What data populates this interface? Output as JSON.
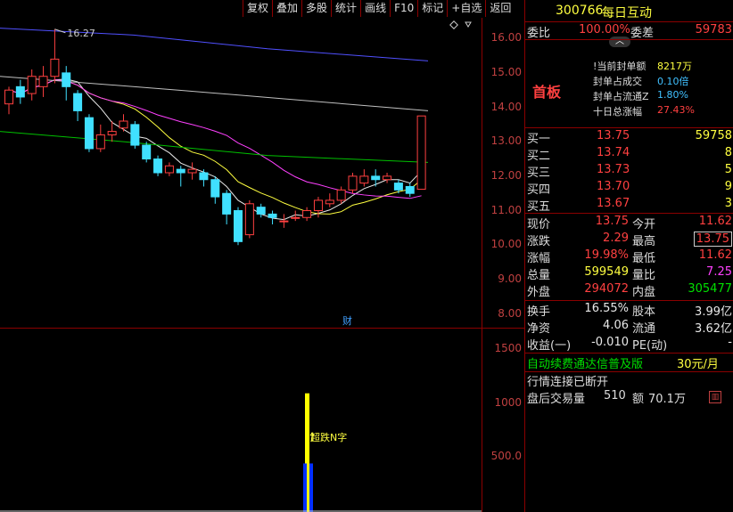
{
  "toolbar": [
    "复权",
    "叠加",
    "多股",
    "统计",
    "画线",
    "F10",
    "标记",
    "+自选",
    "返回"
  ],
  "header": {
    "code": "300766",
    "name": "每日互动"
  },
  "commission": {
    "ratio_label": "委比",
    "ratio": "100.00%",
    "diff_label": "委差",
    "diff": "59783"
  },
  "limit_up": {
    "tag": "首板",
    "lines": [
      {
        "label": "!当前封单额",
        "value": "8217万"
      },
      {
        "label": "封单占成交",
        "value": "0.10倍"
      },
      {
        "label": "封单占流通Z",
        "value": "1.80%"
      },
      {
        "label": "十日总涨幅",
        "value": "27.43%"
      }
    ]
  },
  "bids": [
    {
      "label": "买一",
      "price": "13.75",
      "vol": "59758"
    },
    {
      "label": "买二",
      "price": "13.74",
      "vol": "8"
    },
    {
      "label": "买三",
      "price": "13.73",
      "vol": "5"
    },
    {
      "label": "买四",
      "price": "13.70",
      "vol": "9"
    },
    {
      "label": "买五",
      "price": "13.67",
      "vol": "3"
    }
  ],
  "quote": [
    {
      "l1": "现价",
      "v1": "13.75",
      "l2": "今开",
      "v2": "11.62"
    },
    {
      "l1": "涨跌",
      "v1": "2.29",
      "l2": "最高",
      "v2": "13.75"
    },
    {
      "l1": "涨幅",
      "v1": "19.98%",
      "l2": "最低",
      "v2": "11.62"
    },
    {
      "l1": "总量",
      "v1": "599549",
      "l2": "量比",
      "v2": "7.25"
    },
    {
      "l1": "外盘",
      "v1": "294072",
      "l2": "内盘",
      "v2": "305477"
    }
  ],
  "fund": [
    {
      "l1": "换手",
      "v1": "16.55%",
      "l2": "股本",
      "v2": "3.99亿"
    },
    {
      "l1": "净资",
      "v1": "4.06",
      "l2": "流通",
      "v2": "3.62亿"
    },
    {
      "l1": "收益(一)",
      "v1": "-0.010",
      "l2": "PE(动)",
      "v2": "-"
    }
  ],
  "promo": {
    "text": "自动续费通达信普及版",
    "price": "30元/月"
  },
  "status": "行情连接已断开",
  "after_hours": {
    "label": "盘后交易量",
    "vol": "510",
    "amt_label": "额",
    "amt": "70.1万"
  },
  "chart": {
    "high_label": "16.27",
    "cai_label": "财",
    "signal_label": "超跌N字",
    "price_ticks": [
      "16.00",
      "15.00",
      "14.00",
      "13.00",
      "12.00",
      "11.00",
      "10.00",
      "9.00",
      "8.00"
    ],
    "vol_ticks": [
      "1500",
      "1000",
      "500.0"
    ]
  },
  "chart_data": {
    "type": "candlestick",
    "ylim": [
      7.6,
      16.6
    ],
    "candles": [
      [
        14.1,
        14.5,
        13.8,
        14.6
      ],
      [
        14.6,
        14.3,
        14.1,
        14.8
      ],
      [
        14.4,
        14.9,
        14.2,
        15.1
      ],
      [
        14.6,
        14.9,
        14.3,
        15.2
      ],
      [
        14.9,
        15.4,
        14.7,
        16.27
      ],
      [
        15.0,
        14.6,
        14.2,
        15.2
      ],
      [
        14.4,
        13.9,
        13.6,
        14.5
      ],
      [
        13.7,
        12.8,
        12.7,
        13.8
      ],
      [
        12.8,
        13.2,
        12.7,
        13.5
      ],
      [
        13.2,
        13.3,
        13.0,
        13.6
      ],
      [
        13.4,
        13.6,
        13.3,
        13.8
      ],
      [
        13.5,
        12.9,
        12.8,
        13.6
      ],
      [
        12.9,
        12.5,
        12.4,
        13.0
      ],
      [
        12.5,
        12.1,
        12.0,
        12.6
      ],
      [
        12.1,
        12.3,
        12.0,
        12.4
      ],
      [
        12.2,
        12.1,
        11.7,
        12.3
      ],
      [
        12.1,
        12.2,
        11.9,
        12.4
      ],
      [
        12.1,
        11.9,
        11.7,
        12.2
      ],
      [
        11.9,
        11.4,
        11.2,
        12.0
      ],
      [
        11.5,
        10.9,
        10.6,
        11.6
      ],
      [
        11.0,
        10.1,
        10.0,
        11.1
      ],
      [
        10.3,
        11.2,
        10.2,
        11.3
      ],
      [
        11.1,
        10.9,
        10.8,
        11.2
      ],
      [
        10.9,
        10.8,
        10.6,
        11.0
      ],
      [
        10.7,
        10.7,
        10.5,
        10.9
      ],
      [
        10.8,
        10.8,
        10.7,
        11.0
      ],
      [
        10.8,
        11.0,
        10.7,
        11.1
      ],
      [
        11.0,
        11.3,
        10.8,
        11.4
      ],
      [
        11.2,
        11.3,
        11.1,
        11.5
      ],
      [
        11.3,
        11.6,
        11.2,
        11.7
      ],
      [
        11.6,
        12.0,
        11.5,
        12.1
      ],
      [
        11.8,
        12.0,
        11.7,
        12.2
      ],
      [
        12.0,
        11.9,
        11.7,
        12.2
      ],
      [
        11.9,
        12.0,
        11.8,
        12.1
      ],
      [
        11.8,
        11.6,
        11.5,
        11.9
      ],
      [
        11.7,
        11.5,
        11.4,
        11.8
      ],
      [
        11.62,
        13.75,
        11.62,
        13.75
      ]
    ],
    "volume": {
      "bars": [
        1100
      ],
      "ticks": [
        1500,
        1000,
        500
      ]
    }
  }
}
